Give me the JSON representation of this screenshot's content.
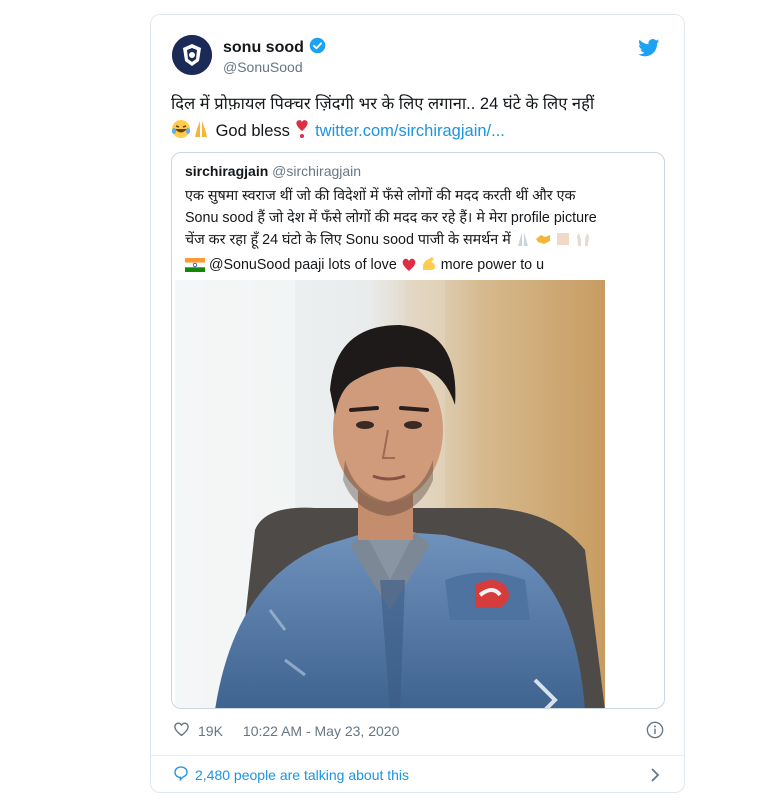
{
  "tweet": {
    "author_name": "sonu sood",
    "author_handle": "@SonuSood",
    "text_line1": "दिल में प्रोफ़ायल पिक्चर ज़िंदगी भर के लिए लगाना.. 24 घंटे के लिए नहीं",
    "text_god_bless": "God bless",
    "link_text": "twitter.com/sirchiragjain/...",
    "likes": "19K",
    "timestamp": "10:22 AM - May 23, 2020",
    "conversation": "2,480 people are talking about this"
  },
  "quoted": {
    "author_name": "sirchiragjain",
    "author_handle": "@sirchiragjain",
    "line1": "एक सुषमा स्वराज थीं जो की विदेशों में फँसे  लोगों की मदद करती थीं  और एक",
    "line2": "Sonu sood हैं जो देश में फँसे लोगों की मदद कर रहे हैं। मे मेरा profile picture",
    "line3": "चेंज कर रहा हूँ 24 घंटो के लिए Sonu sood पाजी के समर्थन में",
    "line4_mention": "@SonuSood paaji lots of love",
    "line4_end": "more power to u"
  },
  "icons": {
    "verified": "verified-badge-icon",
    "bird": "twitter-bird-icon",
    "heart": "heart-outline-icon",
    "info": "info-icon",
    "comment": "comment-bubble-icon",
    "chevron": "chevron-right-icon"
  },
  "colors": {
    "link": "#1b95e0",
    "muted": "#657786",
    "border": "#e1e8ed"
  }
}
